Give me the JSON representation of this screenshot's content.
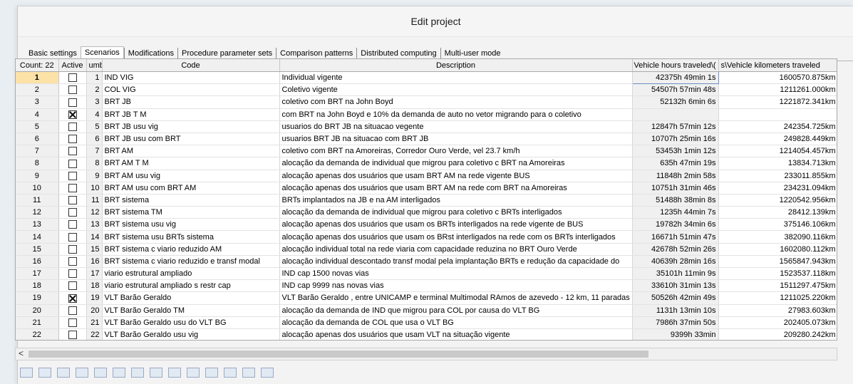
{
  "window": {
    "title": "Edit project"
  },
  "tabs": [
    {
      "label": "Basic settings",
      "active": false
    },
    {
      "label": "Scenarios",
      "active": true
    },
    {
      "label": "Modifications",
      "active": false
    },
    {
      "label": "Procedure parameter sets",
      "active": false
    },
    {
      "label": "Comparison patterns",
      "active": false
    },
    {
      "label": "Distributed computing",
      "active": false
    },
    {
      "label": "Multi-user mode",
      "active": false
    }
  ],
  "grid": {
    "headers": {
      "count": "Count: 22",
      "active": "Active",
      "number": "umb",
      "code": "Code",
      "description": "Description",
      "vht": ")\\Vehicle hours traveled",
      "vkt": "s\\Vehicle kilometers traveled"
    },
    "rows": [
      {
        "row": "1",
        "active": false,
        "number": "1",
        "code": "IND VIG",
        "description": "Individual vigente",
        "vht": "42375h 49min 1s",
        "vkt": "1600570.875km"
      },
      {
        "row": "2",
        "active": false,
        "number": "2",
        "code": "COL VIG",
        "description": "Coletivo vigente",
        "vht": "54507h 57min 48s",
        "vkt": "1211261.000km"
      },
      {
        "row": "3",
        "active": false,
        "number": "3",
        "code": "BRT JB",
        "description": "coletivo com BRT na John Boyd",
        "vht": "52132h 6min 6s",
        "vkt": "1221872.341km"
      },
      {
        "row": "4",
        "active": true,
        "number": "4",
        "code": "BRT JB T M",
        "description": "com BRT na John Boyd e 10% da demanda de auto no vetor migrando para o coletivo",
        "vht": "",
        "vkt": ""
      },
      {
        "row": "5",
        "active": false,
        "number": "5",
        "code": "BRT JB usu vig",
        "description": "usuarios do BRT JB na situacao vegente",
        "vht": "12847h 57min 12s",
        "vkt": "242354.725km"
      },
      {
        "row": "6",
        "active": false,
        "number": "6",
        "code": "BRT JB usu com BRT",
        "description": "usuarios BRT JB na situacao com BRT JB",
        "vht": "10707h 25min 16s",
        "vkt": "249828.449km"
      },
      {
        "row": "7",
        "active": false,
        "number": "7",
        "code": "BRT AM",
        "description": "coletivo com BRT na Amoreiras, Corredor Ouro Verde, vel 23.7 km/h",
        "vht": "53453h 1min 12s",
        "vkt": "1214054.457km"
      },
      {
        "row": "8",
        "active": false,
        "number": "8",
        "code": "BRT AM T M",
        "description": "alocação da demanda de individual que migrou para coletivo c BRT na Amoreiras",
        "vht": "635h 47min 19s",
        "vkt": "13834.713km"
      },
      {
        "row": "9",
        "active": false,
        "number": "9",
        "code": "BRT AM usu vig",
        "description": "alocação apenas dos usuários que usam BRT AM na rede vigente BUS",
        "vht": "11848h 2min 58s",
        "vkt": "233011.855km"
      },
      {
        "row": "10",
        "active": false,
        "number": "10",
        "code": "BRT AM usu com BRT AM",
        "description": "alocação apenas dos usuários que usam BRT AM na rede com BRT na Amoreiras",
        "vht": "10751h 31min 46s",
        "vkt": "234231.094km"
      },
      {
        "row": "11",
        "active": false,
        "number": "11",
        "code": "BRT sistema",
        "description": "BRTs implantados na JB e na AM interligados",
        "vht": "51488h 38min 8s",
        "vkt": "1220542.956km"
      },
      {
        "row": "12",
        "active": false,
        "number": "12",
        "code": "BRT sistema TM",
        "description": "alocação da demanda de individual que migrou para coletivo c BRTs interligados",
        "vht": "1235h 44min 7s",
        "vkt": "28412.139km"
      },
      {
        "row": "13",
        "active": false,
        "number": "13",
        "code": "BRT sistema usu vig",
        "description": "alocação apenas dos usuários que usam os BRTs interligados na rede vigente de BUS",
        "vht": "19782h 34min 6s",
        "vkt": "375146.106km"
      },
      {
        "row": "14",
        "active": false,
        "number": "14",
        "code": "BRT sistema usu BRTs sistema",
        "description": "alocação apenas dos usuários que usam os BRst interligados na rede com os BRTs interligados",
        "vht": "16671h 51min 47s",
        "vkt": "382090.116km"
      },
      {
        "row": "15",
        "active": false,
        "number": "15",
        "code": "BRT sistema c viario reduzido AM",
        "description": "alocação individual total na rede viaria com capacidade reduzina no BRT Ouro Verde",
        "vht": "42678h 52min 26s",
        "vkt": "1602080.112km"
      },
      {
        "row": "16",
        "active": false,
        "number": "16",
        "code": "BRT sistema c viario reduzido e transf modal",
        "description": "alocação individual descontado transf modal pela implantação BRTs e redução da capacidade do",
        "vht": "40639h 28min 16s",
        "vkt": "1565847.943km"
      },
      {
        "row": "17",
        "active": false,
        "number": "17",
        "code": "viario estrutural ampliado",
        "description": "IND cap 1500 novas vias",
        "vht": "35101h 11min 9s",
        "vkt": "1523537.118km"
      },
      {
        "row": "18",
        "active": false,
        "number": "18",
        "code": "viario estrutural ampliado s restr cap",
        "description": "IND cap 9999 nas novas vias",
        "vht": "33610h 31min 13s",
        "vkt": "1511297.475km"
      },
      {
        "row": "19",
        "active": true,
        "number": "19",
        "code": "VLT Barão Geraldo",
        "description": "VLT Barão Geraldo , entre UNICAMP e terminal Multimodal RAmos de azevedo - 12 km, 11 paradas",
        "vht": "50526h 42min 49s",
        "vkt": "1211025.220km"
      },
      {
        "row": "20",
        "active": false,
        "number": "20",
        "code": "VLT Barão Geraldo TM",
        "description": "alocação da demanda de IND que migrou para COL por causa do VLT BG",
        "vht": "1131h 13min 10s",
        "vkt": "27983.603km"
      },
      {
        "row": "21",
        "active": false,
        "number": "21",
        "code": "VLT Barão Geraldo usu do VLT BG",
        "description": "alocação da demanda de COL que usa o VLT BG",
        "vht": "7986h 37min 50s",
        "vkt": "202405.073km"
      },
      {
        "row": "22",
        "active": false,
        "number": "22",
        "code": "VLT Barão Geraldo usu vig",
        "description": "alocação apenas dos usuários que usam VLT na situação vigente",
        "vht": "9399h 33min",
        "vkt": "209280.242km"
      }
    ]
  },
  "scrollbar": {
    "left_arrow": "<"
  },
  "colors": {
    "selected_row_header": "#fce2a7",
    "header_bg": "#f0f0f0",
    "grid_line": "#d7d7d7"
  }
}
